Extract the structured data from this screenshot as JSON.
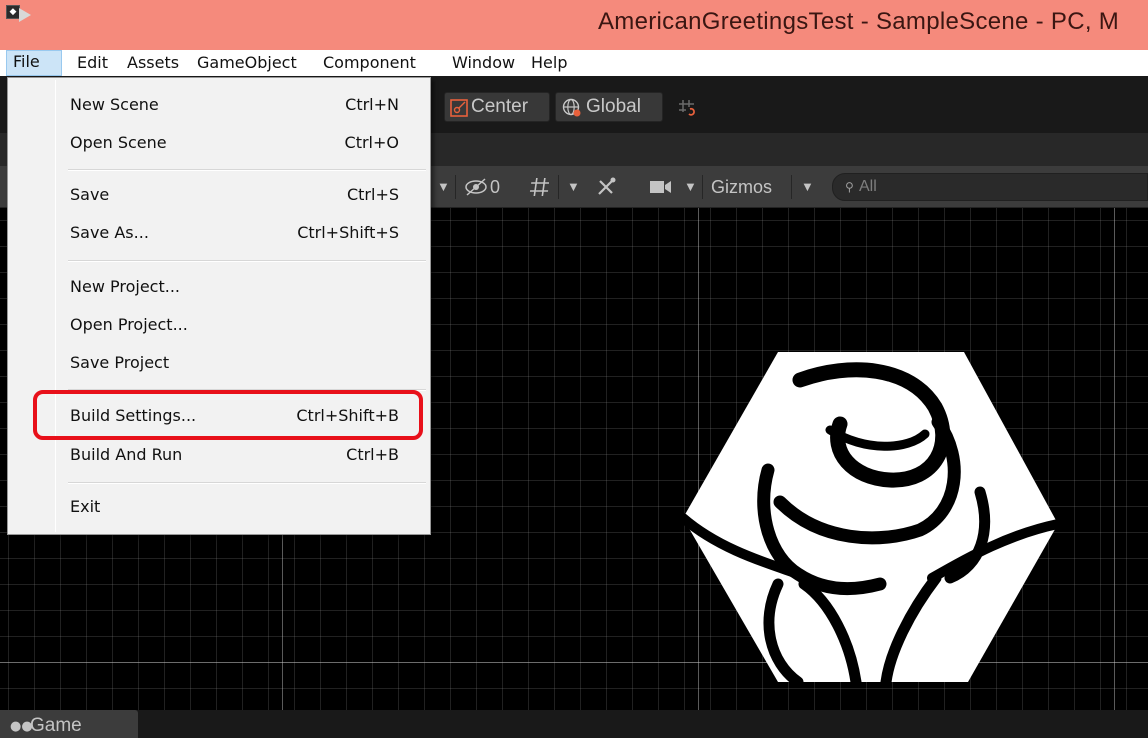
{
  "window": {
    "title": "AmericanGreetingsTest - SampleScene - PC, M"
  },
  "menubar": {
    "items": [
      {
        "label": "File",
        "active": true
      },
      {
        "label": "Edit"
      },
      {
        "label": "Assets"
      },
      {
        "label": "GameObject"
      },
      {
        "label": "Component"
      },
      {
        "label": "Window"
      },
      {
        "label": "Help"
      }
    ]
  },
  "file_menu": {
    "items": [
      {
        "label": "New Scene",
        "shortcut": "Ctrl+N"
      },
      {
        "label": "Open Scene",
        "shortcut": "Ctrl+O"
      },
      {
        "label": "Save",
        "shortcut": "Ctrl+S"
      },
      {
        "label": "Save As...",
        "shortcut": "Ctrl+Shift+S"
      },
      {
        "label": "New Project...",
        "shortcut": ""
      },
      {
        "label": "Open Project...",
        "shortcut": ""
      },
      {
        "label": "Save Project",
        "shortcut": ""
      },
      {
        "label": "Build Settings...",
        "shortcut": "Ctrl+Shift+B",
        "highlighted": true
      },
      {
        "label": "Build And Run",
        "shortcut": "Ctrl+B"
      },
      {
        "label": "Exit",
        "shortcut": ""
      }
    ]
  },
  "toolbar": {
    "pivot_label": "Center",
    "space_label": "Global",
    "icons": [
      "pivot-icon",
      "globe-icon",
      "grid-snap-icon",
      "play-icon"
    ]
  },
  "scene_toolbar": {
    "hidden_count": "0",
    "gizmos_label": "Gizmos",
    "search_placeholder": "All",
    "icons": [
      "visibility-icon",
      "grid-icon",
      "tools-icon",
      "camera-icon"
    ]
  },
  "bottom_tabs": {
    "game_label": "Game"
  },
  "colors": {
    "title_bar": "#f58a7c",
    "menu_active": "#cce4f7",
    "highlight": "#e8101a",
    "editor_bg": "#191919"
  }
}
